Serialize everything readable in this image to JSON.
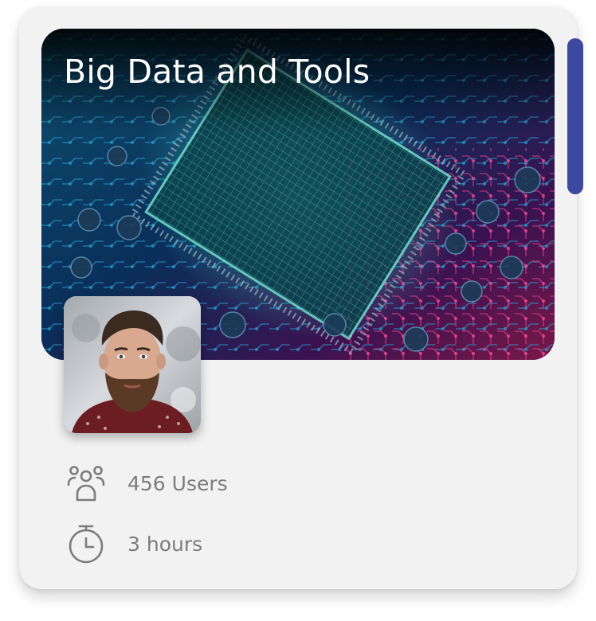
{
  "card": {
    "title": "Big Data and Tools",
    "users_label": "456 Users",
    "duration_label": "3 hours"
  },
  "icons": {
    "users": "users-group-icon",
    "duration": "stopwatch-icon"
  },
  "colors": {
    "card_background": "#f2f2f2",
    "scrollbar": "#3c49a0",
    "title_text": "#ffffff",
    "meta_text": "#7c7c7c"
  }
}
